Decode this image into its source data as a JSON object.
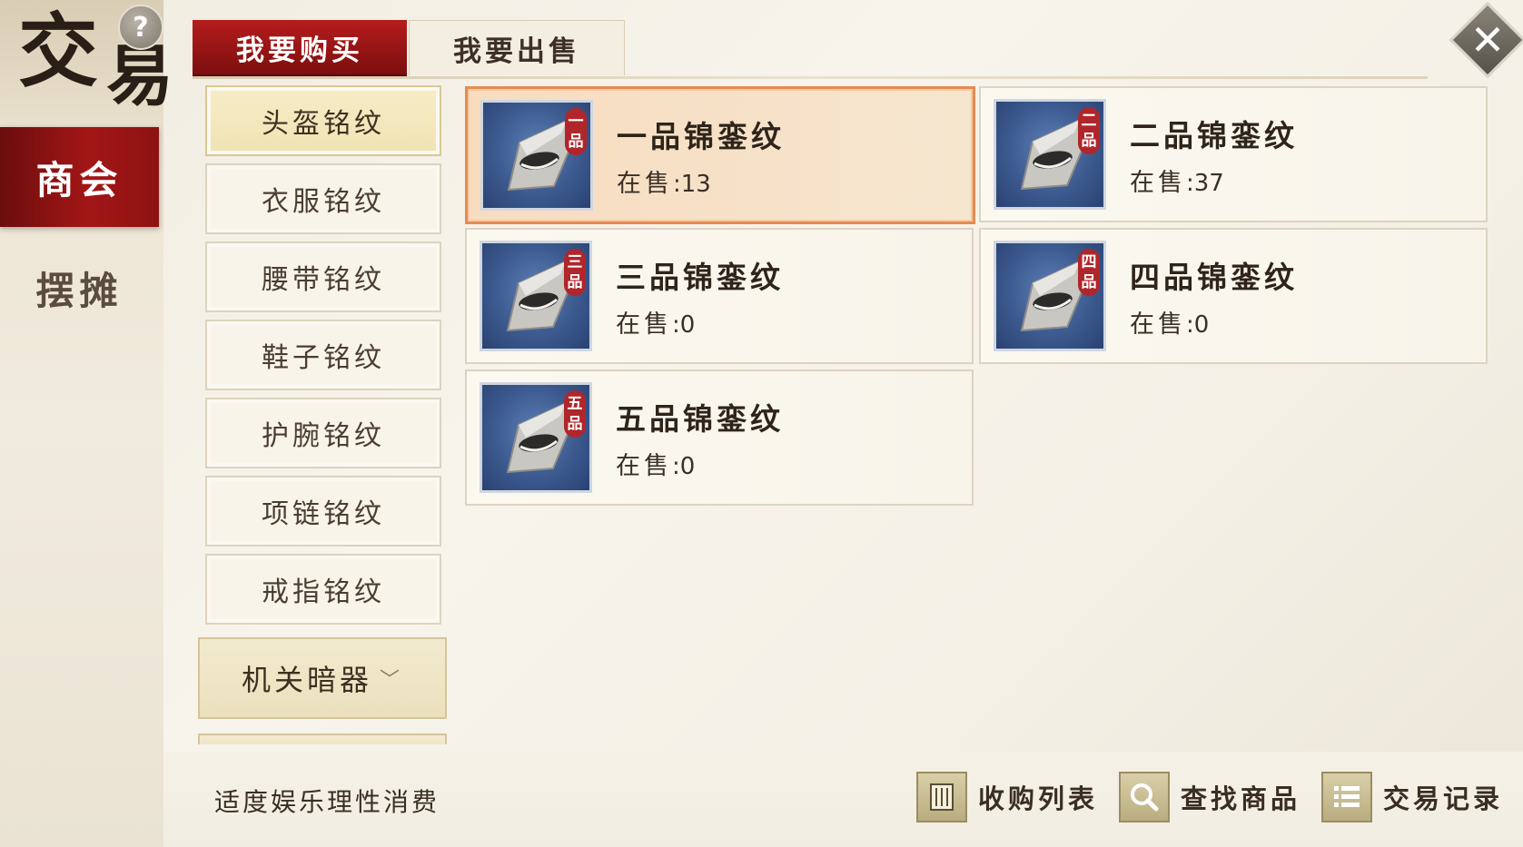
{
  "window": {
    "title_char1": "交",
    "title_char2": "易",
    "help_label": "?",
    "close_label": "✕"
  },
  "side_tabs": [
    {
      "label": "商会",
      "active": true
    },
    {
      "label": "摆摊",
      "active": false
    }
  ],
  "top_tabs": [
    {
      "label": "我要购买",
      "active": true
    },
    {
      "label": "我要出售",
      "active": false
    }
  ],
  "categories": [
    {
      "label": "头盔铭纹",
      "active": true
    },
    {
      "label": "衣服铭纹",
      "active": false
    },
    {
      "label": "腰带铭纹",
      "active": false
    },
    {
      "label": "鞋子铭纹",
      "active": false
    },
    {
      "label": "护腕铭纹",
      "active": false
    },
    {
      "label": "项链铭纹",
      "active": false
    },
    {
      "label": "戒指铭纹",
      "active": false
    }
  ],
  "category_group": {
    "label": "机关暗器",
    "icon": "chevron-down-icon"
  },
  "items": [
    {
      "name": "一品锦銮纹",
      "sale_label": "在售",
      "sale_count": ":13",
      "grade1": "一",
      "grade2": "品",
      "selected": true
    },
    {
      "name": "二品锦銮纹",
      "sale_label": "在售",
      "sale_count": ":37",
      "grade1": "二",
      "grade2": "品",
      "selected": false
    },
    {
      "name": "三品锦銮纹",
      "sale_label": "在售",
      "sale_count": ":0",
      "grade1": "三",
      "grade2": "品",
      "selected": false
    },
    {
      "name": "四品锦銮纹",
      "sale_label": "在售",
      "sale_count": ":0",
      "grade1": "四",
      "grade2": "品",
      "selected": false
    },
    {
      "name": "五品锦銮纹",
      "sale_label": "在售",
      "sale_count": ":0",
      "grade1": "五",
      "grade2": "品",
      "selected": false
    }
  ],
  "bottom": {
    "notice": "适度娱乐理性消费",
    "actions": [
      {
        "label": "收购列表",
        "icon": "scroll-icon"
      },
      {
        "label": "查找商品",
        "icon": "search-icon"
      },
      {
        "label": "交易记录",
        "icon": "list-icon"
      }
    ]
  },
  "colors": {
    "accent_red": "#a31616",
    "selected_border": "#e58a52",
    "grade_tag": "#b0262a",
    "icon_bg": "#3c5a8f"
  }
}
